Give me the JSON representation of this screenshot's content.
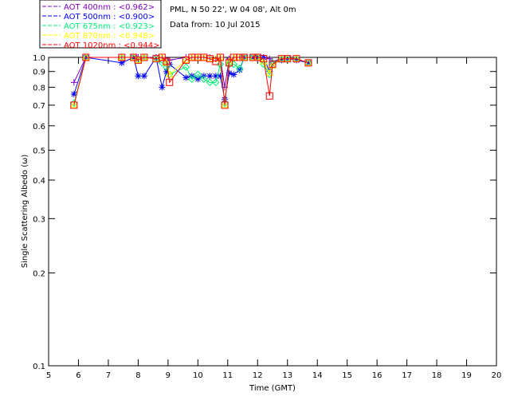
{
  "header": {
    "site": "PML, N 50 22', W 04 08', Alt 0m",
    "date": "Data from: 10 Jul 2015"
  },
  "chart_data": {
    "type": "line",
    "xlabel": "Time (GMT)",
    "ylabel": "Single Scattering Albedo (ω)",
    "xlim": [
      5,
      20
    ],
    "ylim": [
      0.1,
      1.0
    ],
    "yscale": "log",
    "xticks": [
      "5",
      "6",
      "7",
      "8",
      "9",
      "10",
      "11",
      "12",
      "13",
      "14",
      "15",
      "16",
      "17",
      "18",
      "19",
      "20"
    ],
    "yticks": [
      {
        "v": 0.1,
        "l": "0.1"
      },
      {
        "v": 0.2,
        "l": "0.2"
      },
      {
        "v": 0.3,
        "l": "0.3"
      },
      {
        "v": 0.4,
        "l": "0.4"
      },
      {
        "v": 0.5,
        "l": "0.5"
      },
      {
        "v": 0.6,
        "l": "0.6"
      },
      {
        "v": 0.7,
        "l": "0.7"
      },
      {
        "v": 0.8,
        "l": "0.8"
      },
      {
        "v": 0.9,
        "l": "0.9"
      },
      {
        "v": 1.0,
        "l": "1.0"
      }
    ],
    "legend_position": "top-left",
    "series": [
      {
        "name": "AOT  400nm : <0.962>",
        "color": "#7f00bf",
        "marker": "plus",
        "x": [
          5.85,
          6.25,
          7.45,
          7.85,
          8.0,
          8.2,
          8.6,
          8.8,
          8.95,
          9.05,
          9.6,
          9.8,
          10.0,
          10.2,
          10.4,
          10.6,
          10.75,
          10.9,
          11.05,
          11.2,
          11.4,
          11.55,
          11.85,
          12.0,
          12.2,
          12.4,
          12.5,
          12.8,
          13.0,
          13.3,
          13.7
        ],
        "y": [
          0.83,
          1.0,
          1.0,
          1.0,
          1.0,
          1.0,
          1.0,
          1.0,
          0.98,
          0.98,
          1.0,
          1.0,
          1.0,
          1.0,
          1.0,
          0.99,
          1.0,
          0.8,
          0.99,
          1.0,
          1.0,
          1.0,
          1.0,
          1.0,
          1.0,
          0.99,
          0.97,
          0.99,
          0.99,
          0.99,
          0.96
        ]
      },
      {
        "name": "AOT  500nm : <0.900>",
        "color": "#0000ff",
        "marker": "star",
        "x": [
          5.85,
          6.25,
          7.45,
          7.85,
          8.0,
          8.2,
          8.6,
          8.8,
          8.95,
          9.05,
          9.6,
          9.8,
          10.0,
          10.2,
          10.4,
          10.6,
          10.75,
          10.9,
          11.05,
          11.2,
          11.4,
          11.55,
          11.85,
          12.0,
          12.2,
          12.4,
          12.5,
          12.8,
          13.0,
          13.3,
          13.7
        ],
        "y": [
          0.76,
          1.0,
          0.96,
          1.0,
          0.87,
          0.87,
          1.0,
          0.8,
          0.9,
          0.95,
          0.86,
          0.87,
          0.85,
          0.87,
          0.87,
          0.87,
          0.87,
          0.73,
          0.89,
          0.88,
          0.91,
          1.0,
          1.0,
          1.0,
          1.0,
          0.9,
          0.95,
          0.98,
          0.99,
          0.98,
          0.96
        ]
      },
      {
        "name": "AOT  675nm : <0.923>",
        "color": "#00ee77",
        "marker": "diamond",
        "x": [
          5.85,
          6.25,
          7.45,
          7.85,
          8.0,
          8.2,
          8.6,
          8.8,
          8.95,
          9.05,
          9.6,
          9.8,
          10.0,
          10.2,
          10.4,
          10.6,
          10.75,
          10.9,
          11.05,
          11.2,
          11.4,
          11.55,
          11.85,
          12.0,
          12.2,
          12.4,
          12.5,
          12.8,
          13.0,
          13.3,
          13.7
        ],
        "y": [
          0.71,
          1.0,
          1.0,
          1.0,
          0.98,
          1.0,
          0.99,
          0.96,
          0.93,
          0.88,
          0.93,
          0.85,
          0.88,
          0.85,
          0.83,
          0.83,
          0.95,
          0.71,
          0.95,
          0.95,
          0.92,
          1.0,
          1.0,
          1.0,
          0.95,
          0.88,
          0.96,
          0.99,
          0.99,
          0.99,
          0.96
        ]
      },
      {
        "name": "AOT  870nm : <0.948>",
        "color": "#ffff00",
        "marker": "triangle",
        "x": [
          5.85,
          6.25,
          7.45,
          7.85,
          8.0,
          8.2,
          8.6,
          8.8,
          8.95,
          9.05,
          9.6,
          9.8,
          10.0,
          10.2,
          10.4,
          10.6,
          10.75,
          10.9,
          11.05,
          11.2,
          11.4,
          11.55,
          11.85,
          12.0,
          12.2,
          12.4,
          12.5,
          12.8,
          13.0,
          13.3,
          13.7
        ],
        "y": [
          0.7,
          1.0,
          1.0,
          1.0,
          0.98,
          1.0,
          0.99,
          1.0,
          0.96,
          0.88,
          0.98,
          1.0,
          1.0,
          1.0,
          0.99,
          0.99,
          1.0,
          0.7,
          0.97,
          1.0,
          1.0,
          1.0,
          1.0,
          1.0,
          0.97,
          0.89,
          0.94,
          0.99,
          0.99,
          0.99,
          0.96
        ]
      },
      {
        "name": "AOT 1020nm : <0.944>",
        "color": "#ff0000",
        "marker": "square",
        "x": [
          5.85,
          6.25,
          7.45,
          7.85,
          8.0,
          8.2,
          8.6,
          8.8,
          8.95,
          9.05,
          9.6,
          9.8,
          10.0,
          10.2,
          10.4,
          10.6,
          10.75,
          10.9,
          11.05,
          11.2,
          11.4,
          11.55,
          11.85,
          12.0,
          12.2,
          12.4,
          12.5,
          12.8,
          13.0,
          13.3,
          13.7
        ],
        "y": [
          0.7,
          1.0,
          1.0,
          1.0,
          0.98,
          1.0,
          0.99,
          1.0,
          0.97,
          0.83,
          0.98,
          1.0,
          1.0,
          1.0,
          0.99,
          0.97,
          1.0,
          0.7,
          0.96,
          1.0,
          1.0,
          1.0,
          1.0,
          1.0,
          0.99,
          0.75,
          0.95,
          0.99,
          0.99,
          0.99,
          0.96
        ]
      }
    ]
  }
}
